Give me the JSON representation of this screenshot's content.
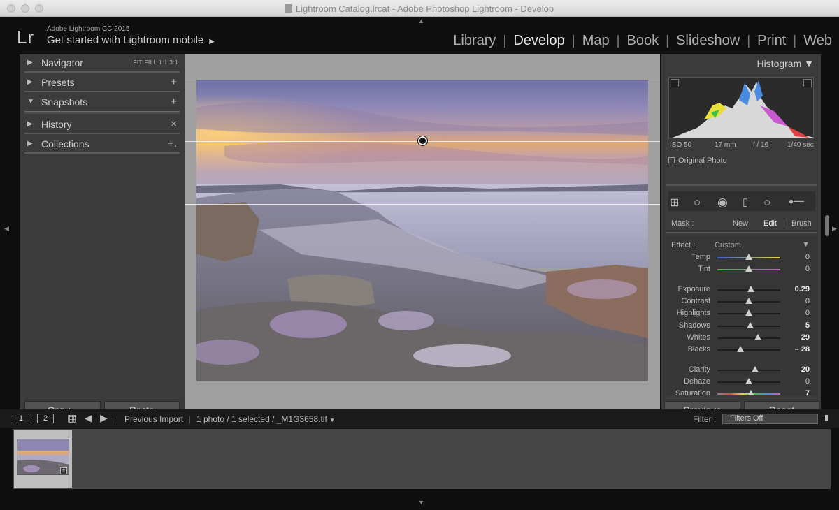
{
  "window": {
    "title": "Lightroom Catalog.lrcat - Adobe Photoshop Lightroom - Develop"
  },
  "brand": {
    "logo": "Lr",
    "product": "Adobe Lightroom CC 2015",
    "mobile_prompt": "Get started with Lightroom mobile"
  },
  "modules": [
    "Library",
    "Develop",
    "Map",
    "Book",
    "Slideshow",
    "Print",
    "Web"
  ],
  "active_module": "Develop",
  "left_panel": {
    "navigator": {
      "label": "Navigator",
      "options": "FIT   FILL   1:1   3:1"
    },
    "presets": {
      "label": "Presets",
      "action": "+"
    },
    "snapshots": {
      "label": "Snapshots",
      "action": "+"
    },
    "history": {
      "label": "History",
      "action": "×"
    },
    "collections": {
      "label": "Collections",
      "action": "+."
    },
    "copy_label": "Copy...",
    "paste_label": "Paste"
  },
  "histogram": {
    "header": "Histogram",
    "iso": "ISO 50",
    "focal_length": "17 mm",
    "aperture": "f / 16",
    "shutter": "1/40 sec",
    "original_photo": "Original Photo"
  },
  "mask": {
    "label": "Mask :",
    "new": "New",
    "edit": "Edit",
    "brush": "Brush"
  },
  "effect": {
    "label": "Effect :",
    "value": "Custom",
    "sliders": [
      {
        "label": "Temp",
        "value": "0",
        "fraction": 0.5
      },
      {
        "label": "Tint",
        "value": "0",
        "fraction": 0.5
      },
      {
        "label": "Exposure",
        "value": "0.29",
        "fraction": 0.53
      },
      {
        "label": "Contrast",
        "value": "0",
        "fraction": 0.5
      },
      {
        "label": "Highlights",
        "value": "0",
        "fraction": 0.5
      },
      {
        "label": "Shadows",
        "value": "5",
        "fraction": 0.52
      },
      {
        "label": "Whites",
        "value": "29",
        "fraction": 0.64
      },
      {
        "label": "Blacks",
        "value": "– 28",
        "fraction": 0.37
      },
      {
        "label": "Clarity",
        "value": "20",
        "fraction": 0.6
      },
      {
        "label": "Dehaze",
        "value": "0",
        "fraction": 0.5
      },
      {
        "label": "Saturation",
        "value": "7",
        "fraction": 0.53
      }
    ]
  },
  "right_buttons": {
    "previous": "Previous",
    "reset": "Reset"
  },
  "filmstrip_bar": {
    "view1": "1",
    "view2": "2",
    "source": "Previous Import",
    "selection": "1 photo / 1 selected / _M1G3658.tif",
    "filter_label": "Filter :",
    "filter_value": "Filters Off"
  },
  "icons": {
    "traffic_lights": "window-controls",
    "grid": "grid-view-icon",
    "nav_back": "arrow-left-icon",
    "nav_forward": "arrow-right-icon"
  }
}
